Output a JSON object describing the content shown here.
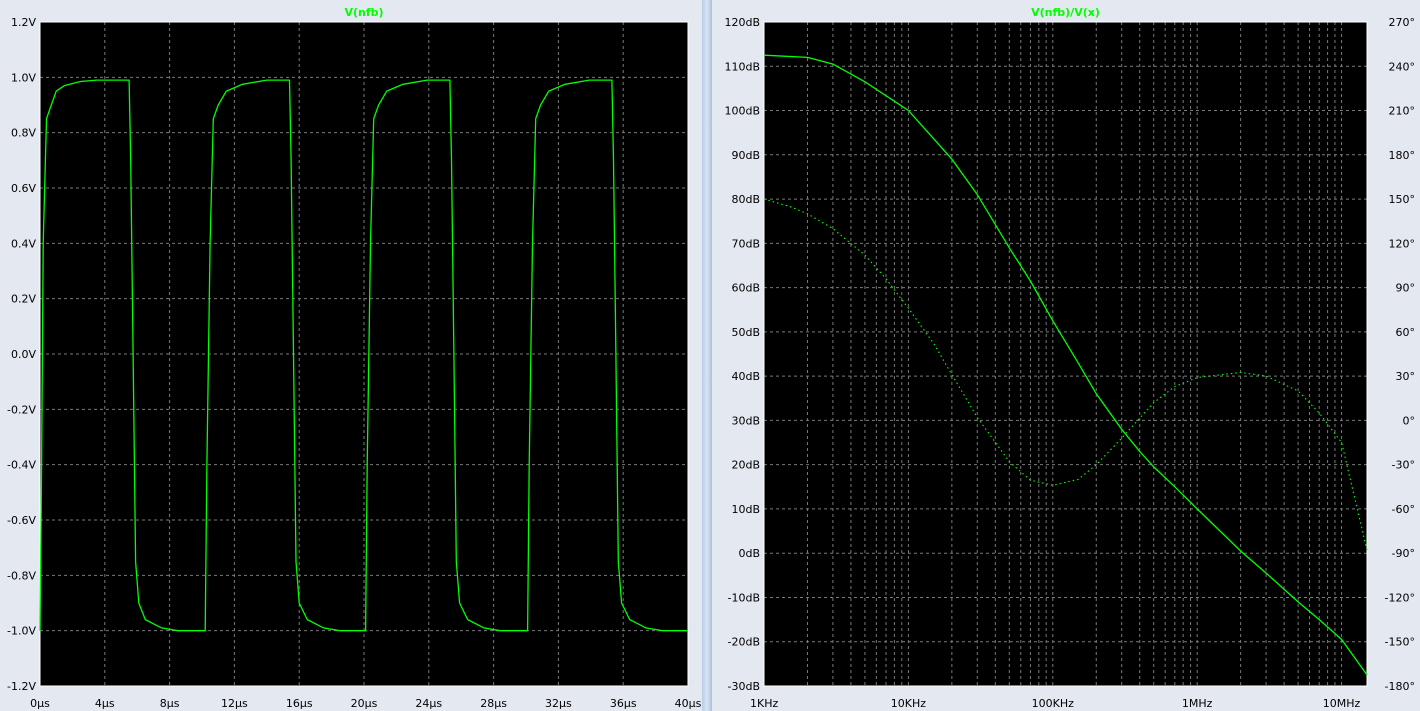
{
  "chart_data": [
    {
      "type": "line",
      "title": "V(nfb)",
      "x_unit": "µs",
      "xlim": [
        0,
        40
      ],
      "ylim": [
        -1.2,
        1.2
      ],
      "x_ticks": [
        "0µs",
        "4µs",
        "8µs",
        "12µs",
        "16µs",
        "20µs",
        "24µs",
        "28µs",
        "32µs",
        "36µs",
        "40µs"
      ],
      "y_ticks": [
        "1.2V",
        "1.0V",
        "0.8V",
        "0.6V",
        "0.4V",
        "0.2V",
        "0.0V",
        "-0.2V",
        "-0.4V",
        "-0.6V",
        "-0.8V",
        "-1.0V",
        "-1.2V"
      ],
      "grid": true,
      "series": [
        {
          "color": "#00ff00",
          "points": [
            [
              0,
              -1.0
            ],
            [
              0.1,
              -0.4
            ],
            [
              0.2,
              0.4
            ],
            [
              0.4,
              0.85
            ],
            [
              0.7,
              0.9
            ],
            [
              1.0,
              0.95
            ],
            [
              1.5,
              0.97
            ],
            [
              2.5,
              0.985
            ],
            [
              3.5,
              0.99
            ],
            [
              5.5,
              0.99
            ],
            [
              5.6,
              0.7
            ],
            [
              5.75,
              0.0
            ],
            [
              5.9,
              -0.75
            ],
            [
              6.1,
              -0.9
            ],
            [
              6.5,
              -0.96
            ],
            [
              7.5,
              -0.99
            ],
            [
              8.5,
              -1.0
            ],
            [
              10.2,
              -1.0
            ],
            [
              10.3,
              -0.4
            ],
            [
              10.5,
              0.4
            ],
            [
              10.7,
              0.85
            ],
            [
              11.0,
              0.9
            ],
            [
              11.5,
              0.95
            ],
            [
              12.5,
              0.975
            ],
            [
              14.0,
              0.99
            ],
            [
              15.4,
              0.99
            ],
            [
              15.5,
              0.7
            ],
            [
              15.65,
              0.0
            ],
            [
              15.8,
              -0.75
            ],
            [
              16.0,
              -0.9
            ],
            [
              16.5,
              -0.96
            ],
            [
              17.5,
              -0.99
            ],
            [
              18.5,
              -1.0
            ],
            [
              20.1,
              -1.0
            ],
            [
              20.2,
              -0.4
            ],
            [
              20.4,
              0.4
            ],
            [
              20.6,
              0.85
            ],
            [
              20.9,
              0.9
            ],
            [
              21.4,
              0.95
            ],
            [
              22.4,
              0.975
            ],
            [
              23.9,
              0.99
            ],
            [
              25.3,
              0.99
            ],
            [
              25.4,
              0.7
            ],
            [
              25.55,
              0.0
            ],
            [
              25.7,
              -0.75
            ],
            [
              25.9,
              -0.9
            ],
            [
              26.4,
              -0.96
            ],
            [
              27.4,
              -0.99
            ],
            [
              28.4,
              -1.0
            ],
            [
              30.1,
              -1.0
            ],
            [
              30.2,
              -0.4
            ],
            [
              30.4,
              0.4
            ],
            [
              30.6,
              0.85
            ],
            [
              30.9,
              0.9
            ],
            [
              31.4,
              0.95
            ],
            [
              32.4,
              0.975
            ],
            [
              33.9,
              0.99
            ],
            [
              35.3,
              0.99
            ],
            [
              35.4,
              0.7
            ],
            [
              35.55,
              0.0
            ],
            [
              35.7,
              -0.75
            ],
            [
              35.9,
              -0.9
            ],
            [
              36.4,
              -0.96
            ],
            [
              37.4,
              -0.99
            ],
            [
              38.4,
              -1.0
            ],
            [
              40.0,
              -1.0
            ]
          ]
        }
      ]
    },
    {
      "type": "line",
      "title": "V(nfb)/V(x)",
      "x_scale": "log",
      "xlim": [
        1000,
        15000000
      ],
      "ylim": [
        -30,
        120
      ],
      "y2lim": [
        -180,
        270
      ],
      "x_ticks": [
        {
          "value": 1000,
          "label": "1KHz"
        },
        {
          "value": 10000,
          "label": "10KHz"
        },
        {
          "value": 100000,
          "label": "100KHz"
        },
        {
          "value": 1000000,
          "label": "1MHz"
        },
        {
          "value": 10000000,
          "label": "10MHz"
        }
      ],
      "y_ticks": [
        "120dB",
        "110dB",
        "100dB",
        "90dB",
        "80dB",
        "70dB",
        "60dB",
        "50dB",
        "40dB",
        "30dB",
        "20dB",
        "10dB",
        "0dB",
        "-10dB",
        "-20dB",
        "-30dB"
      ],
      "y2_ticks": [
        "270°",
        "240°",
        "210°",
        "180°",
        "150°",
        "120°",
        "90°",
        "60°",
        "30°",
        "0°",
        "-30°",
        "-60°",
        "-90°",
        "-120°",
        "-150°",
        "-180°"
      ],
      "grid": true,
      "series": [
        {
          "color": "#00ff00",
          "style": "solid",
          "axis": "left",
          "points": [
            [
              1000,
              112.5
            ],
            [
              2000,
              112.0
            ],
            [
              3000,
              110.5
            ],
            [
              5000,
              106.5
            ],
            [
              10000,
              100.0
            ],
            [
              20000,
              89.0
            ],
            [
              30000,
              81.0
            ],
            [
              50000,
              69.0
            ],
            [
              70000,
              61.5
            ],
            [
              100000,
              52.5
            ],
            [
              150000,
              43.0
            ],
            [
              200000,
              36.0
            ],
            [
              300000,
              28.0
            ],
            [
              400000,
              23.0
            ],
            [
              500000,
              19.5
            ],
            [
              700000,
              15.0
            ],
            [
              1000000,
              10.0
            ],
            [
              2000000,
              0.5
            ],
            [
              3000000,
              -4.5
            ],
            [
              5000000,
              -11.0
            ],
            [
              7000000,
              -15.0
            ],
            [
              10000000,
              -19.5
            ],
            [
              15000000,
              -27.5
            ]
          ]
        },
        {
          "color": "#00ff00",
          "style": "dotted",
          "axis": "right",
          "points": [
            [
              1000,
              150.0
            ],
            [
              1500,
              145.0
            ],
            [
              2000,
              140.0
            ],
            [
              3000,
              130.0
            ],
            [
              5000,
              112.0
            ],
            [
              7000,
              96.0
            ],
            [
              10000,
              76.0
            ],
            [
              15000,
              52.0
            ],
            [
              20000,
              31.0
            ],
            [
              30000,
              2.0
            ],
            [
              50000,
              -28.0
            ],
            [
              70000,
              -40.5
            ],
            [
              100000,
              -44.0
            ],
            [
              150000,
              -40.0
            ],
            [
              200000,
              -30.0
            ],
            [
              300000,
              -12.0
            ],
            [
              500000,
              12.0
            ],
            [
              700000,
              23.0
            ],
            [
              1000000,
              29.0
            ],
            [
              2000000,
              32.5
            ],
            [
              3000000,
              30.0
            ],
            [
              5000000,
              20.0
            ],
            [
              7000000,
              5.0
            ],
            [
              10000000,
              -15.0
            ],
            [
              15000000,
              -88.0
            ]
          ]
        }
      ]
    }
  ]
}
